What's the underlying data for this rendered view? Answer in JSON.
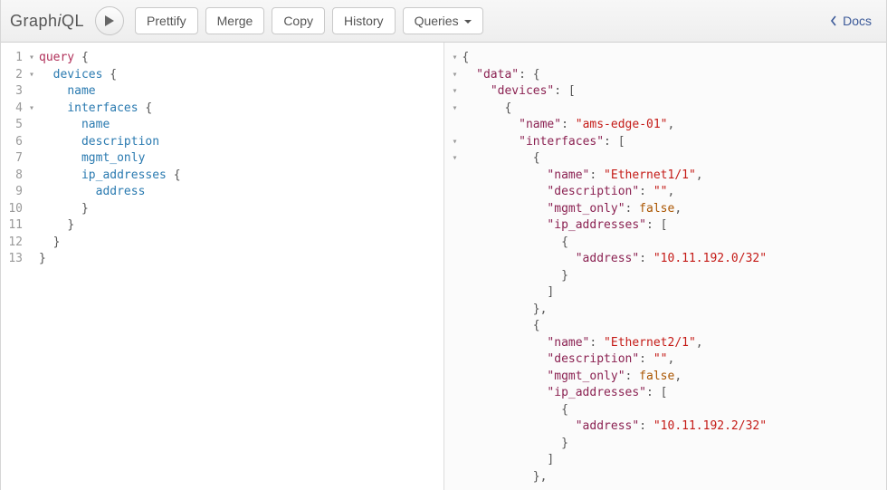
{
  "app_title": "GraphiQL",
  "logo_parts": {
    "pre": "Graph",
    "mid": "i",
    "post": "QL"
  },
  "toolbar": {
    "prettify": "Prettify",
    "merge": "Merge",
    "copy": "Copy",
    "history": "History",
    "queries": "Queries"
  },
  "docs_label": "Docs",
  "query_lines": [
    {
      "n": "1",
      "fold": true,
      "indent": 0,
      "tokens": [
        [
          "kw",
          "query"
        ],
        [
          "punc",
          " {"
        ]
      ]
    },
    {
      "n": "2",
      "fold": true,
      "indent": 1,
      "tokens": [
        [
          "attr",
          "devices"
        ],
        [
          "punc",
          " {"
        ]
      ]
    },
    {
      "n": "3",
      "fold": false,
      "indent": 2,
      "tokens": [
        [
          "attr",
          "name"
        ]
      ]
    },
    {
      "n": "4",
      "fold": true,
      "indent": 2,
      "tokens": [
        [
          "attr",
          "interfaces"
        ],
        [
          "punc",
          " {"
        ]
      ]
    },
    {
      "n": "5",
      "fold": false,
      "indent": 3,
      "tokens": [
        [
          "attr",
          "name"
        ]
      ]
    },
    {
      "n": "6",
      "fold": false,
      "indent": 3,
      "tokens": [
        [
          "attr",
          "description"
        ]
      ]
    },
    {
      "n": "7",
      "fold": false,
      "indent": 3,
      "tokens": [
        [
          "attr",
          "mgmt_only"
        ]
      ]
    },
    {
      "n": "8",
      "fold": false,
      "indent": 3,
      "tokens": [
        [
          "attr",
          "ip_addresses"
        ],
        [
          "punc",
          " {"
        ]
      ]
    },
    {
      "n": "9",
      "fold": false,
      "indent": 4,
      "tokens": [
        [
          "attr",
          "address"
        ]
      ]
    },
    {
      "n": "10",
      "fold": false,
      "indent": 3,
      "tokens": [
        [
          "punc",
          "}"
        ]
      ]
    },
    {
      "n": "11",
      "fold": false,
      "indent": 2,
      "tokens": [
        [
          "punc",
          "}"
        ]
      ]
    },
    {
      "n": "12",
      "fold": false,
      "indent": 1,
      "tokens": [
        [
          "punc",
          "}"
        ]
      ]
    },
    {
      "n": "13",
      "fold": false,
      "indent": 0,
      "tokens": [
        [
          "punc",
          "}"
        ]
      ]
    }
  ],
  "result_lines": [
    {
      "fold": true,
      "indent": 0,
      "tokens": [
        [
          "punc",
          "{"
        ]
      ]
    },
    {
      "fold": true,
      "indent": 1,
      "tokens": [
        [
          "prop",
          "\"data\""
        ],
        [
          "punc",
          ": {"
        ]
      ]
    },
    {
      "fold": true,
      "indent": 2,
      "tokens": [
        [
          "prop",
          "\"devices\""
        ],
        [
          "punc",
          ": ["
        ]
      ]
    },
    {
      "fold": true,
      "indent": 3,
      "tokens": [
        [
          "punc",
          "{"
        ]
      ]
    },
    {
      "fold": false,
      "indent": 4,
      "tokens": [
        [
          "prop",
          "\"name\""
        ],
        [
          "punc",
          ": "
        ],
        [
          "str",
          "\"ams-edge-01\""
        ],
        [
          "punc",
          ","
        ]
      ]
    },
    {
      "fold": true,
      "indent": 4,
      "tokens": [
        [
          "prop",
          "\"interfaces\""
        ],
        [
          "punc",
          ": ["
        ]
      ]
    },
    {
      "fold": true,
      "indent": 5,
      "tokens": [
        [
          "punc",
          "{"
        ]
      ]
    },
    {
      "fold": false,
      "indent": 6,
      "tokens": [
        [
          "prop",
          "\"name\""
        ],
        [
          "punc",
          ": "
        ],
        [
          "str",
          "\"Ethernet1/1\""
        ],
        [
          "punc",
          ","
        ]
      ]
    },
    {
      "fold": false,
      "indent": 6,
      "tokens": [
        [
          "prop",
          "\"description\""
        ],
        [
          "punc",
          ": "
        ],
        [
          "str",
          "\"\""
        ],
        [
          "punc",
          ","
        ]
      ]
    },
    {
      "fold": false,
      "indent": 6,
      "tokens": [
        [
          "prop",
          "\"mgmt_only\""
        ],
        [
          "punc",
          ": "
        ],
        [
          "bool",
          "false"
        ],
        [
          "punc",
          ","
        ]
      ]
    },
    {
      "fold": false,
      "indent": 6,
      "tokens": [
        [
          "prop",
          "\"ip_addresses\""
        ],
        [
          "punc",
          ": ["
        ]
      ]
    },
    {
      "fold": false,
      "indent": 7,
      "tokens": [
        [
          "punc",
          "{"
        ]
      ]
    },
    {
      "fold": false,
      "indent": 8,
      "tokens": [
        [
          "prop",
          "\"address\""
        ],
        [
          "punc",
          ": "
        ],
        [
          "str",
          "\"10.11.192.0/32\""
        ]
      ]
    },
    {
      "fold": false,
      "indent": 7,
      "tokens": [
        [
          "punc",
          "}"
        ]
      ]
    },
    {
      "fold": false,
      "indent": 6,
      "tokens": [
        [
          "punc",
          "]"
        ]
      ]
    },
    {
      "fold": false,
      "indent": 5,
      "tokens": [
        [
          "punc",
          "},"
        ]
      ]
    },
    {
      "fold": false,
      "indent": 5,
      "tokens": [
        [
          "punc",
          "{"
        ]
      ]
    },
    {
      "fold": false,
      "indent": 6,
      "tokens": [
        [
          "prop",
          "\"name\""
        ],
        [
          "punc",
          ": "
        ],
        [
          "str",
          "\"Ethernet2/1\""
        ],
        [
          "punc",
          ","
        ]
      ]
    },
    {
      "fold": false,
      "indent": 6,
      "tokens": [
        [
          "prop",
          "\"description\""
        ],
        [
          "punc",
          ": "
        ],
        [
          "str",
          "\"\""
        ],
        [
          "punc",
          ","
        ]
      ]
    },
    {
      "fold": false,
      "indent": 6,
      "tokens": [
        [
          "prop",
          "\"mgmt_only\""
        ],
        [
          "punc",
          ": "
        ],
        [
          "bool",
          "false"
        ],
        [
          "punc",
          ","
        ]
      ]
    },
    {
      "fold": false,
      "indent": 6,
      "tokens": [
        [
          "prop",
          "\"ip_addresses\""
        ],
        [
          "punc",
          ": ["
        ]
      ]
    },
    {
      "fold": false,
      "indent": 7,
      "tokens": [
        [
          "punc",
          "{"
        ]
      ]
    },
    {
      "fold": false,
      "indent": 8,
      "tokens": [
        [
          "prop",
          "\"address\""
        ],
        [
          "punc",
          ": "
        ],
        [
          "str",
          "\"10.11.192.2/32\""
        ]
      ]
    },
    {
      "fold": false,
      "indent": 7,
      "tokens": [
        [
          "punc",
          "}"
        ]
      ]
    },
    {
      "fold": false,
      "indent": 6,
      "tokens": [
        [
          "punc",
          "]"
        ]
      ]
    },
    {
      "fold": false,
      "indent": 5,
      "tokens": [
        [
          "punc",
          "},"
        ]
      ]
    }
  ]
}
